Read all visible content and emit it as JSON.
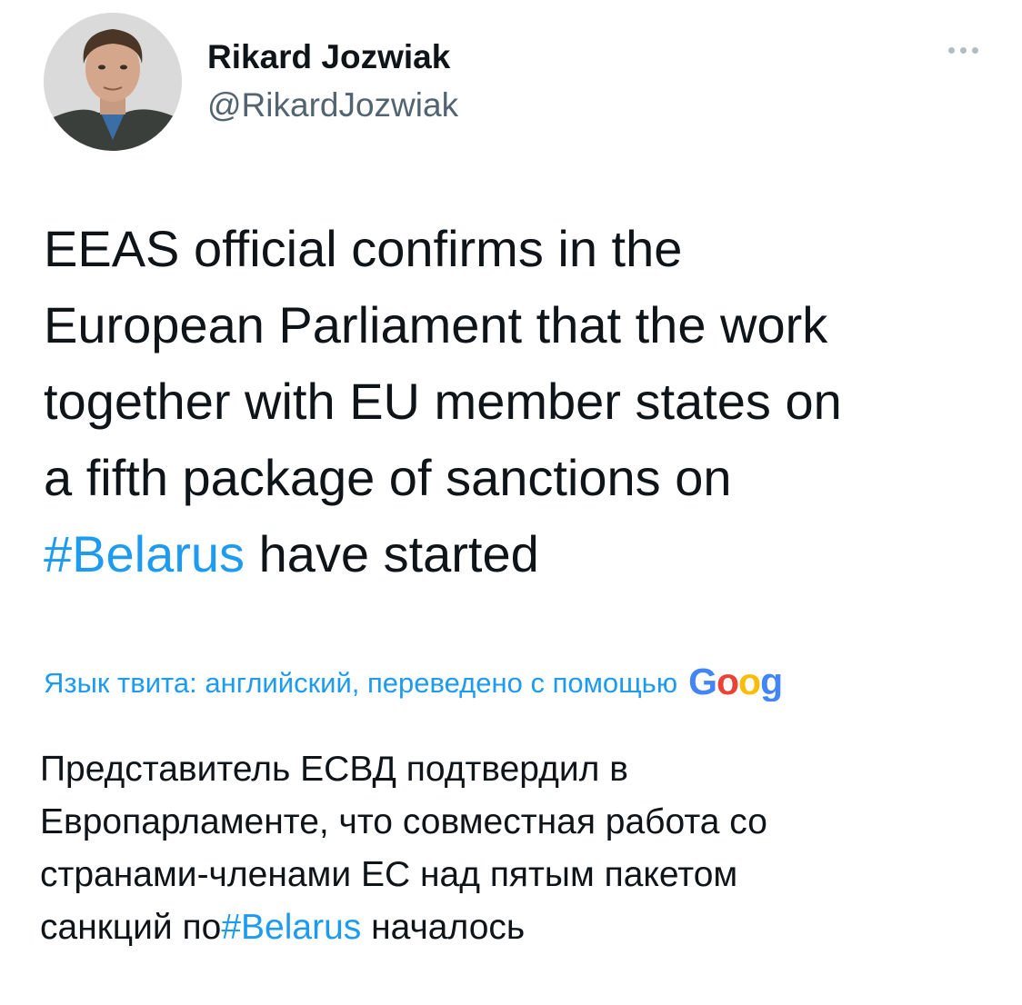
{
  "author": {
    "display_name": "Rikard Jozwiak",
    "handle": "@RikardJozwiak"
  },
  "tweet": {
    "line1": "EEAS official confirms in the",
    "line2": "European Parliament that the work",
    "line3": "together with EU member states on",
    "line4": "a fifth package of sanctions on",
    "hashtag": "#Belarus",
    "line5_rest": " have started"
  },
  "translation": {
    "note": "Язык твита: английский, переведено с помощью",
    "google_letters": [
      "G",
      "o",
      "o",
      "g"
    ],
    "google_colors": [
      "#4285f4",
      "#ea4335",
      "#fbbc05",
      "#4285f4"
    ],
    "line1": "Представитель ЕСВД подтвердил в",
    "line2": "Европарламенте, что совместная работа со",
    "line3": "странами-членами ЕС над пятым пакетом",
    "line4_pre": "санкций по",
    "hashtag": "#Belarus",
    "line4_post": " началось"
  },
  "colors": {
    "link": "#1d9bf0",
    "text": "#0f1419",
    "secondary": "#536471"
  },
  "icons": {
    "more": "more-dots-icon",
    "avatar": "profile-photo"
  }
}
